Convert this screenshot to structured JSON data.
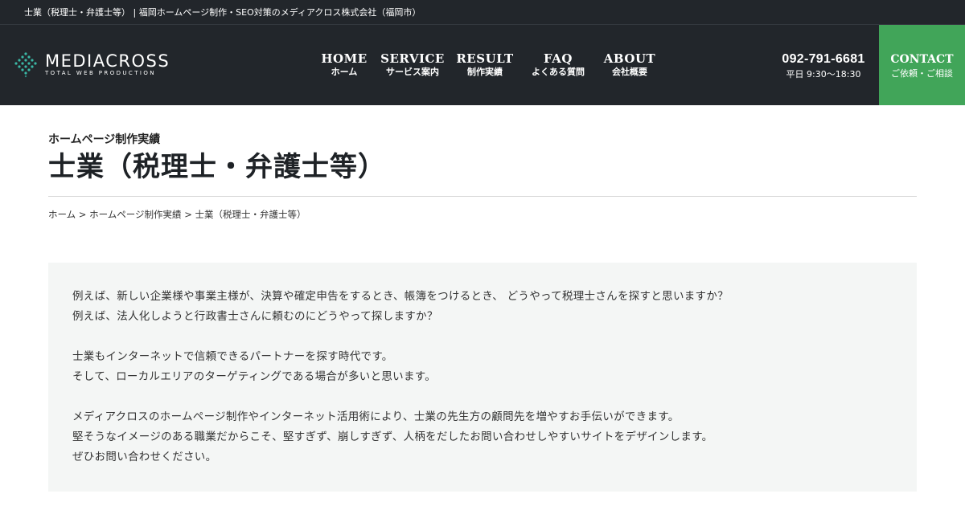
{
  "topbar": {
    "text": "士業（税理士・弁護士等） | 福岡ホームページ制作・SEO対策のメディアクロス株式会社（福岡市）"
  },
  "logo": {
    "name": "MEDIACROSS",
    "tagline": "TOTAL WEB PRODUCTION"
  },
  "nav": [
    {
      "en": "HOME",
      "ja": "ホーム"
    },
    {
      "en": "SERVICE",
      "ja": "サービス案内"
    },
    {
      "en": "RESULT",
      "ja": "制作実績"
    },
    {
      "en": "FAQ",
      "ja": "よくある質問"
    },
    {
      "en": "ABOUT",
      "ja": "会社概要"
    }
  ],
  "phone": {
    "number": "092-791-6681",
    "hours": "平日 9:30～18:30"
  },
  "contact": {
    "en": "CONTACT",
    "ja": "ご依頼・ご相談"
  },
  "page": {
    "section": "ホームページ制作実績",
    "title": "士業（税理士・弁護士等）"
  },
  "breadcrumb": {
    "home": "ホーム",
    "sep": " > ",
    "parent": "ホームページ制作実績",
    "current": "士業（税理士・弁護士等）"
  },
  "intro": {
    "p1": "例えば、新しい企業様や事業主様が、決算や確定申告をするとき、帳簿をつけるとき、 どうやって税理士さんを探すと思いますか？",
    "p2": "例えば、法人化しようと行政書士さんに頼むのにどうやって探しますか？",
    "p3": "士業もインターネットで信頼できるパートナーを探す時代です。",
    "p4": "そして、ローカルエリアのターゲティングである場合が多いと思います。",
    "p5": "メディアクロスのホームページ制作やインターネット活用術により、士業の先生方の顧問先を増やすお手伝いができます。",
    "p6": "堅そうなイメージのある職業だからこそ、堅すぎず、崩しすぎず、人柄をだしたお問い合わせしやすいサイトをデザインします。",
    "p7": "ぜひお問い合わせください。"
  },
  "colors": {
    "header_bg": "#22262b",
    "contact_bg": "#41a559",
    "logo_teal": "#3bb8a6",
    "panel_bg": "#f4f6f5"
  }
}
